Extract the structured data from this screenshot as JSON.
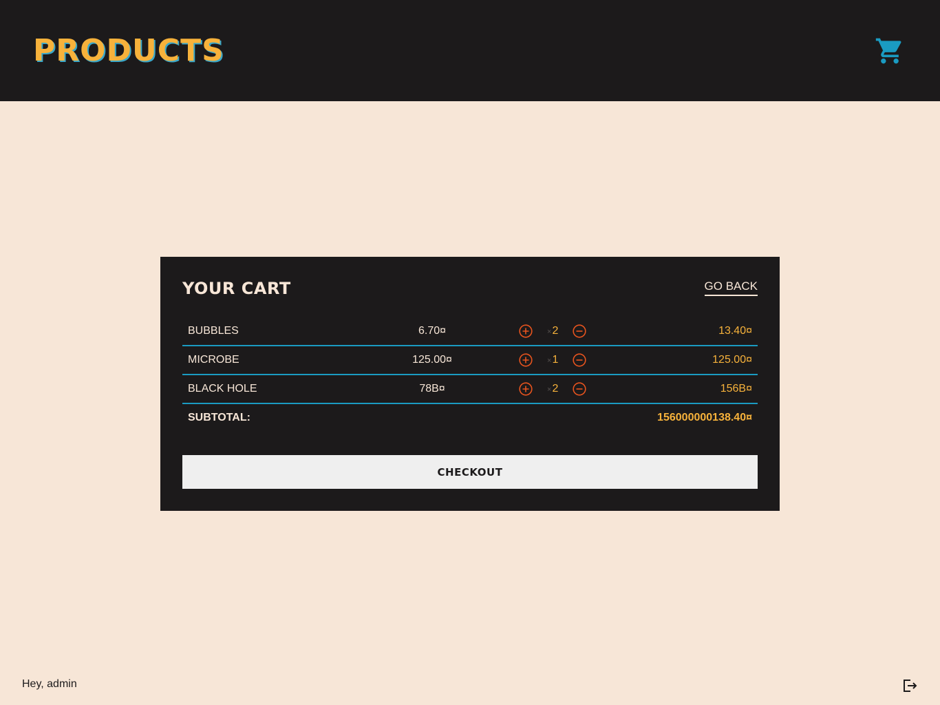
{
  "header": {
    "title": "PRODUCTS",
    "cart_icon": "shopping-cart-icon",
    "colors": {
      "background": "#1c1a1b",
      "title": "#f7b23b",
      "cart": "#1a9bc2"
    }
  },
  "cart": {
    "title": "YOUR CART",
    "go_back_label": "GO BACK",
    "items": [
      {
        "name": "BUBBLES",
        "price": "6.70¤",
        "quantity_prefix": "×",
        "quantity": "2",
        "total": "13.40¤"
      },
      {
        "name": "MICROBE",
        "price": "125.00¤",
        "quantity_prefix": "×",
        "quantity": "1",
        "total": "125.00¤"
      },
      {
        "name": "BLACK HOLE",
        "price": "78B¤",
        "quantity_prefix": "×",
        "quantity": "2",
        "total": "156B¤"
      }
    ],
    "subtotal_label": "SUBTOTAL:",
    "subtotal_value": "156000000138.40¤",
    "checkout_label": "CHECKOUT",
    "icons": {
      "increase": "plus-circle-icon",
      "decrease": "minus-circle-icon"
    },
    "colors": {
      "panel": "#1c1a1b",
      "accent": "#f7b23b",
      "divider": "#1a9bc2",
      "stepper": "#e8541e"
    }
  },
  "footer": {
    "greeting": "Hey, admin",
    "logout_icon": "logout-icon"
  },
  "page": {
    "background": "#f7e6d7"
  }
}
